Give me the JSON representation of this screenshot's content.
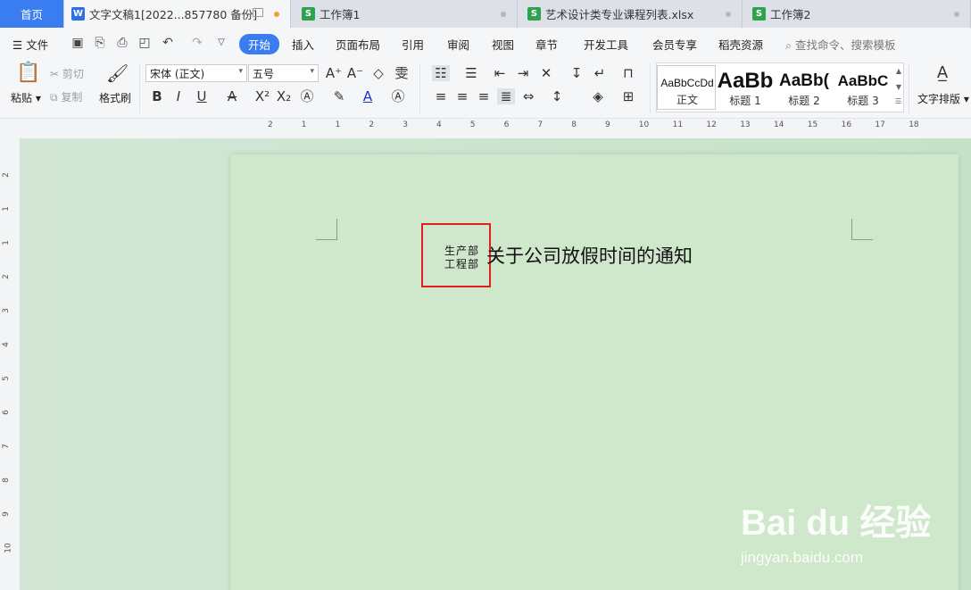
{
  "tabs": [
    {
      "label": "首页"
    },
    {
      "label": "文字文稿1[2022...857780 备份]",
      "icon": "W"
    },
    {
      "label": "工作簿1",
      "icon": "S"
    },
    {
      "label": "艺术设计类专业课程列表.xlsx",
      "icon": "S"
    },
    {
      "label": "工作簿2",
      "icon": "S"
    }
  ],
  "menu": {
    "file": "文件",
    "items": [
      "开始",
      "插入",
      "页面布局",
      "引用",
      "审阅",
      "视图",
      "章节",
      "开发工具",
      "会员专享",
      "稻壳资源"
    ],
    "search_placeholder": "查找命令、搜索模板"
  },
  "ribbon": {
    "paste": "粘贴",
    "cut": "剪切",
    "copy": "复制",
    "format_painter": "格式刷",
    "font_name": "宋体 (正文)",
    "font_size": "五号",
    "styles": [
      {
        "sample": "AaBbCcDd",
        "label": "正文"
      },
      {
        "sample": "AaBb",
        "label": "标题 1"
      },
      {
        "sample": "AaBb(",
        "label": "标题 2"
      },
      {
        "sample": "AaBbC",
        "label": "标题 3"
      }
    ],
    "text_layout": "文字排版"
  },
  "ruler": {
    "h_numbers": [
      "2",
      "1",
      "1",
      "2",
      "3",
      "4",
      "5",
      "6",
      "7",
      "8",
      "9",
      "10",
      "11",
      "12",
      "13",
      "14",
      "15",
      "16",
      "17",
      "18"
    ],
    "v_numbers": [
      "2",
      "1",
      "1",
      "2",
      "3",
      "4",
      "5",
      "6",
      "7",
      "8",
      "9",
      "10"
    ]
  },
  "document": {
    "combined_line1": "生产部",
    "combined_line2": "工程部",
    "title_text": "关于公司放假时间的通知"
  },
  "watermark": {
    "brand": "Bai du 经验",
    "url": "jingyan.baidu.com"
  }
}
